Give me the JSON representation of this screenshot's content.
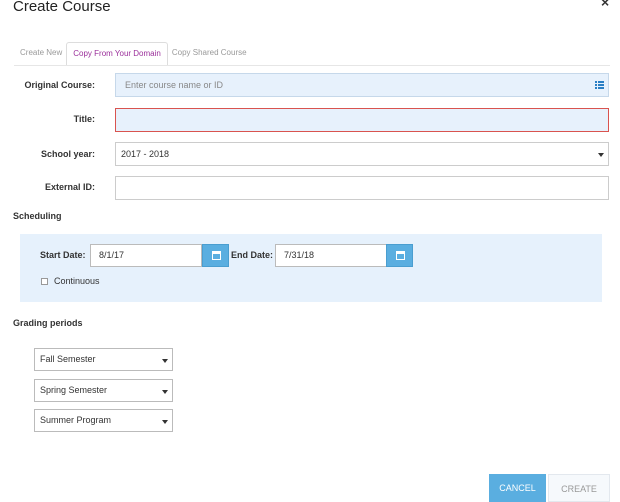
{
  "dialog": {
    "title": "Create Course"
  },
  "tabs": [
    {
      "label": "Create New",
      "active": false
    },
    {
      "label": "Copy From Your Domain",
      "active": true
    },
    {
      "label": "Copy Shared Course",
      "active": false
    }
  ],
  "form": {
    "original_course": {
      "label": "Original Course:",
      "placeholder": "Enter course name or ID"
    },
    "title": {
      "label": "Title:",
      "value": ""
    },
    "school_year": {
      "label": "School year:",
      "value": "2017 - 2018"
    },
    "external_id": {
      "label": "External ID:",
      "value": ""
    }
  },
  "scheduling": {
    "heading": "Scheduling",
    "start_label": "Start Date:",
    "start_value": "8/1/17",
    "end_label": "End Date:",
    "end_value": "7/31/18",
    "continuous_label": "Continuous",
    "continuous_checked": false
  },
  "grading": {
    "heading": "Grading periods",
    "periods": [
      "Fall Semester",
      "Spring Semester",
      "Summer Program"
    ]
  },
  "buttons": {
    "cancel": "CANCEL",
    "create": "CREATE"
  },
  "colors": {
    "accent": "#5aaee0",
    "active_tab": "#9b2f9b",
    "field_bg": "#e7f1fc",
    "error_border": "#d9534f",
    "schedule_bg": "#e6f1fc"
  }
}
